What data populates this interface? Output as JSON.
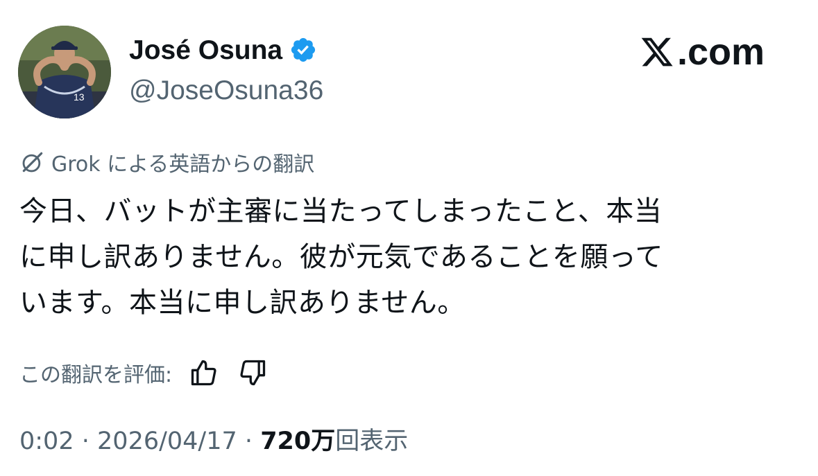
{
  "author": {
    "display_name": "José Osuna",
    "handle": "@JoseOsuna36",
    "verified_icon": "verified-badge-icon",
    "avatar": "profile-photo"
  },
  "brand": {
    "icon": "x-logo-icon",
    "text": ".com"
  },
  "translation": {
    "icon": "grok-icon",
    "label": "Grok による英語からの翻訳"
  },
  "tweet": {
    "lines": [
      "今日、バットが主審に当たってしまったこと、本当",
      "に申し訳ありません。彼が元気であることを願って",
      "います。本当に申し訳ありません。"
    ]
  },
  "rating": {
    "label": "この翻訳を評価:",
    "thumbs_up_icon": "thumbs-up-icon",
    "thumbs_down_icon": "thumbs-down-icon"
  },
  "meta": {
    "time": "0:02",
    "separator": "·",
    "date": "2026/04/17",
    "views_count": "720万",
    "views_label": "回表示"
  },
  "colors": {
    "text": "#0f1419",
    "muted": "#536471",
    "verified": "#1d9bf0"
  }
}
